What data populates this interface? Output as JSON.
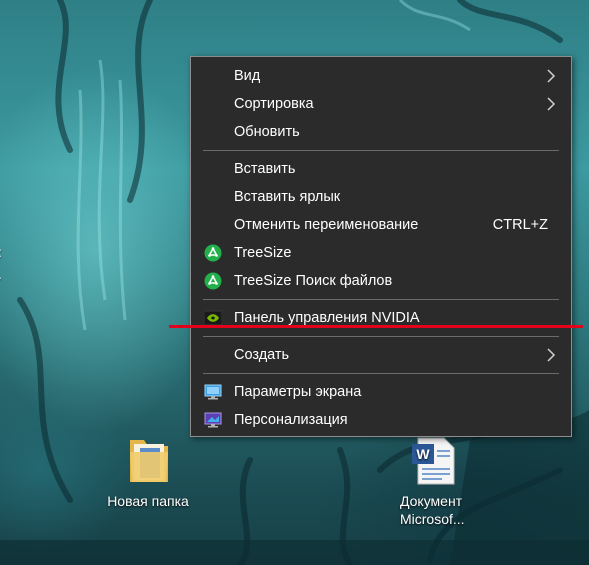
{
  "desktop": {
    "icons": [
      {
        "name": "Новая папка",
        "icon": "folder-icon"
      },
      {
        "name_line1": "Документ",
        "name_line2": "Microsof...",
        "icon": "word-document-icon"
      }
    ]
  },
  "context_menu": {
    "items": [
      {
        "label": "Вид",
        "submenu": true
      },
      {
        "label": "Сортировка",
        "submenu": true
      },
      {
        "label": "Обновить"
      },
      {
        "label": "Вставить"
      },
      {
        "label": "Вставить ярлык"
      },
      {
        "label": "Отменить переименование",
        "shortcut": "CTRL+Z"
      },
      {
        "label": "TreeSize",
        "icon": "treesize-icon"
      },
      {
        "label": "TreeSize Поиск файлов",
        "icon": "treesize-icon"
      },
      {
        "label": "Панель управления NVIDIA",
        "icon": "nvidia-icon",
        "highlighted_by": "red-underline"
      },
      {
        "label": "Создать",
        "submenu": true
      },
      {
        "label": "Параметры экрана",
        "icon": "display-settings-icon"
      },
      {
        "label": "Персонализация",
        "icon": "personalization-icon"
      }
    ]
  },
  "colors": {
    "menu_bg": "#2b2b2b",
    "menu_text": "#ffffff",
    "separator": "#6b6b6b",
    "highlight_line": "#e3001b",
    "treesize_green": "#22b04b",
    "nvidia_green": "#76b900"
  }
}
